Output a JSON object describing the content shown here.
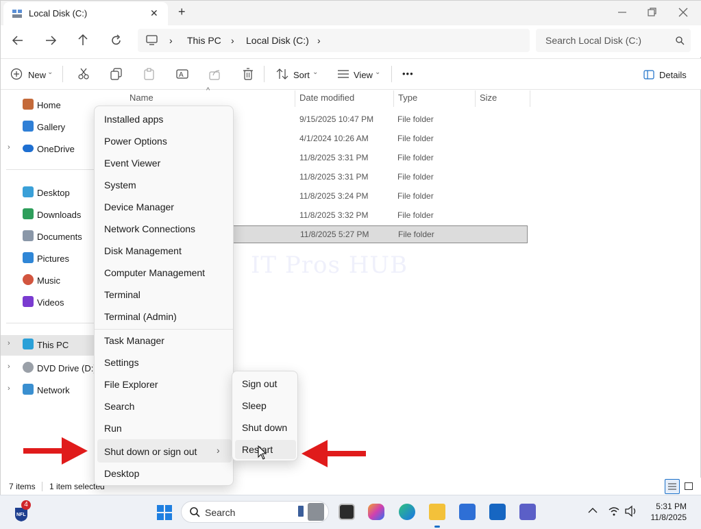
{
  "window": {
    "tab_title": "Local Disk (C:)",
    "close_glyph": "✕",
    "newtab_glyph": "+"
  },
  "navigation": {
    "breadcrumb": [
      "This PC",
      "Local Disk (C:)"
    ],
    "search_placeholder": "Search Local Disk (C:)"
  },
  "toolbar": {
    "new_label": "New",
    "sort_label": "Sort",
    "view_label": "View",
    "more_label": "•••",
    "details_label": "Details"
  },
  "sidebar": {
    "items": [
      {
        "label": "Home",
        "icon": "home-icon",
        "color": "#c46a3a"
      },
      {
        "label": "Gallery",
        "icon": "gallery-icon",
        "color": "#2f7fd6"
      },
      {
        "label": "OneDrive",
        "icon": "cloud-icon",
        "color": "#1e6fd1"
      },
      {
        "label": "Desktop",
        "icon": "desktop-icon",
        "color": "#3aa0d8"
      },
      {
        "label": "Downloads",
        "icon": "download-icon",
        "color": "#2e9e5b"
      },
      {
        "label": "Documents",
        "icon": "document-icon",
        "color": "#8a97a8"
      },
      {
        "label": "Pictures",
        "icon": "picture-icon",
        "color": "#2f86d6"
      },
      {
        "label": "Music",
        "icon": "music-icon",
        "color": "#d2553f"
      },
      {
        "label": "Videos",
        "icon": "video-icon",
        "color": "#7a3bd0"
      },
      {
        "label": "This PC",
        "icon": "computer-icon",
        "color": "#2aa0d8"
      },
      {
        "label": "DVD Drive (D:) H",
        "icon": "disc-icon",
        "color": "#9aa0a8"
      },
      {
        "label": "Network",
        "icon": "network-icon",
        "color": "#3a8fd0"
      }
    ]
  },
  "columns": {
    "name": "Name",
    "date": "Date modified",
    "type": "Type",
    "size": "Size"
  },
  "files": [
    {
      "date": "9/15/2025 10:47 PM",
      "type": "File folder"
    },
    {
      "date": "4/1/2024 10:26 AM",
      "type": "File folder"
    },
    {
      "date": "11/8/2025 3:31 PM",
      "type": "File folder"
    },
    {
      "date": "11/8/2025 3:31 PM",
      "type": "File folder"
    },
    {
      "date": "11/8/2025 3:24 PM",
      "type": "File folder"
    },
    {
      "date": "11/8/2025 3:32 PM",
      "type": "File folder"
    },
    {
      "date": "11/8/2025 5:27 PM",
      "type": "File folder"
    }
  ],
  "watermark": "IT Pros HUB",
  "context_menu": {
    "group1": [
      "Installed apps",
      "Power Options",
      "Event Viewer",
      "System",
      "Device Manager",
      "Network Connections",
      "Disk Management",
      "Computer Management",
      "Terminal",
      "Terminal (Admin)"
    ],
    "group2": [
      "Task Manager",
      "Settings",
      "File Explorer",
      "Search",
      "Run"
    ],
    "shutdown": "Shut down or sign out",
    "desktop": "Desktop"
  },
  "submenu": {
    "items": [
      "Sign out",
      "Sleep",
      "Shut down",
      "Restart"
    ]
  },
  "status": {
    "count": "7 items",
    "selection": "1 item selected"
  },
  "taskbar": {
    "search_label": "Search",
    "badge": "4",
    "time": "5:31 PM",
    "date": "11/8/2025"
  },
  "colors": {
    "accent": "#0067c0",
    "arrow": "#e01b1b"
  }
}
